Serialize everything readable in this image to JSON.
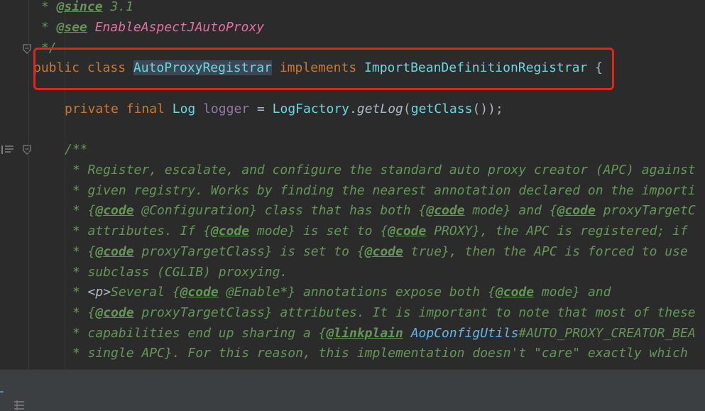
{
  "code": {
    "since_prefix": " * ",
    "since_tag": "@since",
    "since_value": " 3.1",
    "see_prefix": " * ",
    "see_tag": "@see",
    "see_value": "EnableAspectJAutoProxy",
    "comment_end": " */",
    "kw_public": "public",
    "kw_class": "class",
    "class_name": "AutoProxyRegistrar",
    "kw_implements": "implements",
    "interface_name": "ImportBeanDefinitionRegistrar",
    "open_brace": "{",
    "field_private": "private",
    "field_final": "final",
    "field_type": "Log",
    "field_name": "logger",
    "field_assign": " = ",
    "field_factory": "LogFactory",
    "field_dot": ".",
    "field_method": "getLog",
    "field_paren_open": "(",
    "field_call": "getClass",
    "field_tail": "());",
    "javadoc_open": "/**",
    "javadoc": [
      [
        {
          "t": " * Register, escalate, and configure the standard auto proxy creator (APC) against",
          "c": "doc"
        }
      ],
      [
        {
          "t": " * given registry. Works by finding the nearest annotation declared on the importi",
          "c": "doc"
        }
      ],
      [
        {
          "t": " * {",
          "c": "doc"
        },
        {
          "t": "@code",
          "c": "doctag"
        },
        {
          "t": " @Configuration} class that has both {",
          "c": "doc"
        },
        {
          "t": "@code",
          "c": "doctag"
        },
        {
          "t": " mode} and {",
          "c": "doc"
        },
        {
          "t": "@code",
          "c": "doctag"
        },
        {
          "t": " proxyTargetC",
          "c": "doc"
        }
      ],
      [
        {
          "t": " * attributes. If {",
          "c": "doc"
        },
        {
          "t": "@code",
          "c": "doctag"
        },
        {
          "t": " mode} is set to {",
          "c": "doc"
        },
        {
          "t": "@code",
          "c": "doctag"
        },
        {
          "t": " PROXY}, the APC is registered; if",
          "c": "doc"
        }
      ],
      [
        {
          "t": " * {",
          "c": "doc"
        },
        {
          "t": "@code",
          "c": "doctag"
        },
        {
          "t": " proxyTargetClass} is set to {",
          "c": "doc"
        },
        {
          "t": "@code",
          "c": "doctag"
        },
        {
          "t": " true}, then the APC is forced to use",
          "c": "doc"
        }
      ],
      [
        {
          "t": " * subclass (CGLIB) proxying.",
          "c": "doc"
        }
      ],
      [
        {
          "t": " * ",
          "c": "doc"
        },
        {
          "t": "<p>",
          "c": "docgray"
        },
        {
          "t": "Several {",
          "c": "doc"
        },
        {
          "t": "@code",
          "c": "doctag"
        },
        {
          "t": " @Enable*} annotations expose both {",
          "c": "doc"
        },
        {
          "t": "@code",
          "c": "doctag"
        },
        {
          "t": " mode} and",
          "c": "doc"
        }
      ],
      [
        {
          "t": " * {",
          "c": "doc"
        },
        {
          "t": "@code",
          "c": "doctag"
        },
        {
          "t": " proxyTargetClass} attributes. It is important to note that most of these",
          "c": "doc"
        }
      ],
      [
        {
          "t": " * capabilities end up sharing a {",
          "c": "doc"
        },
        {
          "t": "@linkplain",
          "c": "doctag"
        },
        {
          "t": " ",
          "c": "doc"
        },
        {
          "t": "AopConfigUtils",
          "c": "doclink"
        },
        {
          "t": "#AUTO_PROXY_CREATOR_BEA",
          "c": "doc"
        }
      ],
      [
        {
          "t": " * single APC}. For this reason, this implementation doesn't \"care\" exactly which",
          "c": "doc"
        }
      ]
    ]
  },
  "colors": {
    "background": "#2b2b2b",
    "keyword": "#cc7832",
    "comment": "#629755",
    "interface": "#6ad8e2",
    "field": "#9876aa",
    "highlight_box": "#e0241e"
  },
  "icons": {
    "fold_icon": "fold-marker-icon",
    "implements_icon": "implemented-method-icon",
    "statusbar_icon": "structure-icon"
  }
}
